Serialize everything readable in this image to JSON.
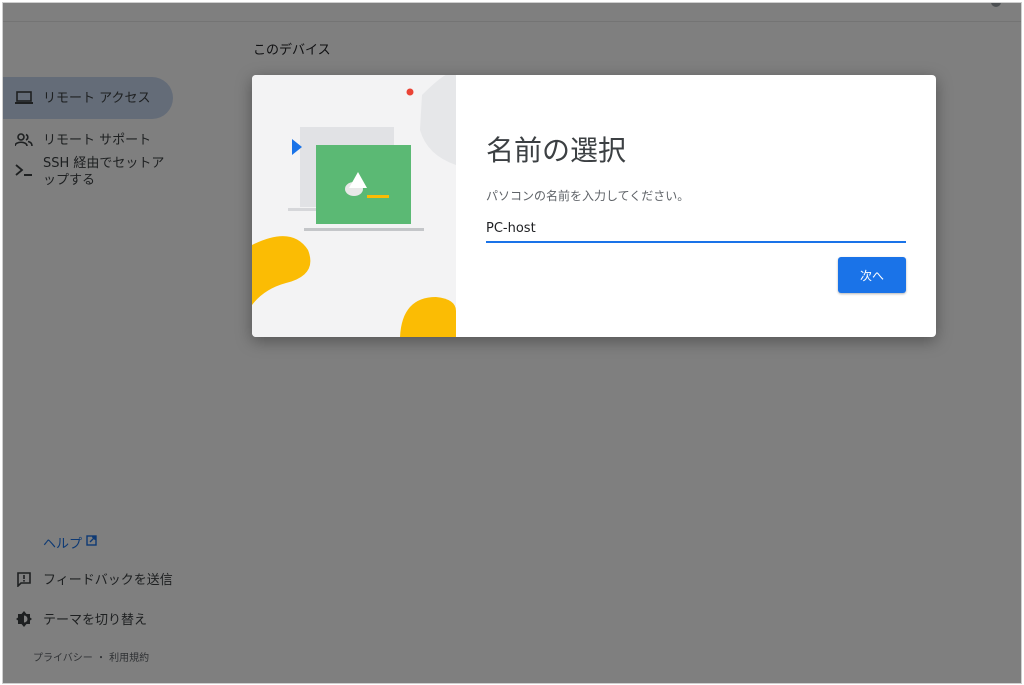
{
  "app": {
    "section_title": "このデバイス"
  },
  "sidebar": {
    "items": [
      {
        "label": "リモート アクセス",
        "icon": "laptop-icon",
        "active": true
      },
      {
        "label": "リモート サポート",
        "icon": "people-icon",
        "active": false
      },
      {
        "label": "SSH 経由でセットア\nップする",
        "icon": "terminal-icon",
        "active": false
      }
    ]
  },
  "footer": {
    "help_label": "ヘルプ",
    "help_icon": "open-in-new-icon",
    "feedback_label": "フィードバックを送信",
    "feedback_icon": "feedback-icon",
    "theme_label": "テーマを切り替え",
    "theme_icon": "brightness-icon",
    "legal_text": "プライバシー ・ 利用規約"
  },
  "dialog": {
    "title": "名前の選択",
    "description": "パソコンの名前を入力してください。",
    "name_value": "PC-host",
    "next_label": "次へ"
  },
  "colors": {
    "accent": "#1a73e8",
    "scrim": "#808080",
    "illustration_green": "#5bb974",
    "illustration_yellow": "#fbbc04",
    "illustration_red": "#ea4335"
  }
}
